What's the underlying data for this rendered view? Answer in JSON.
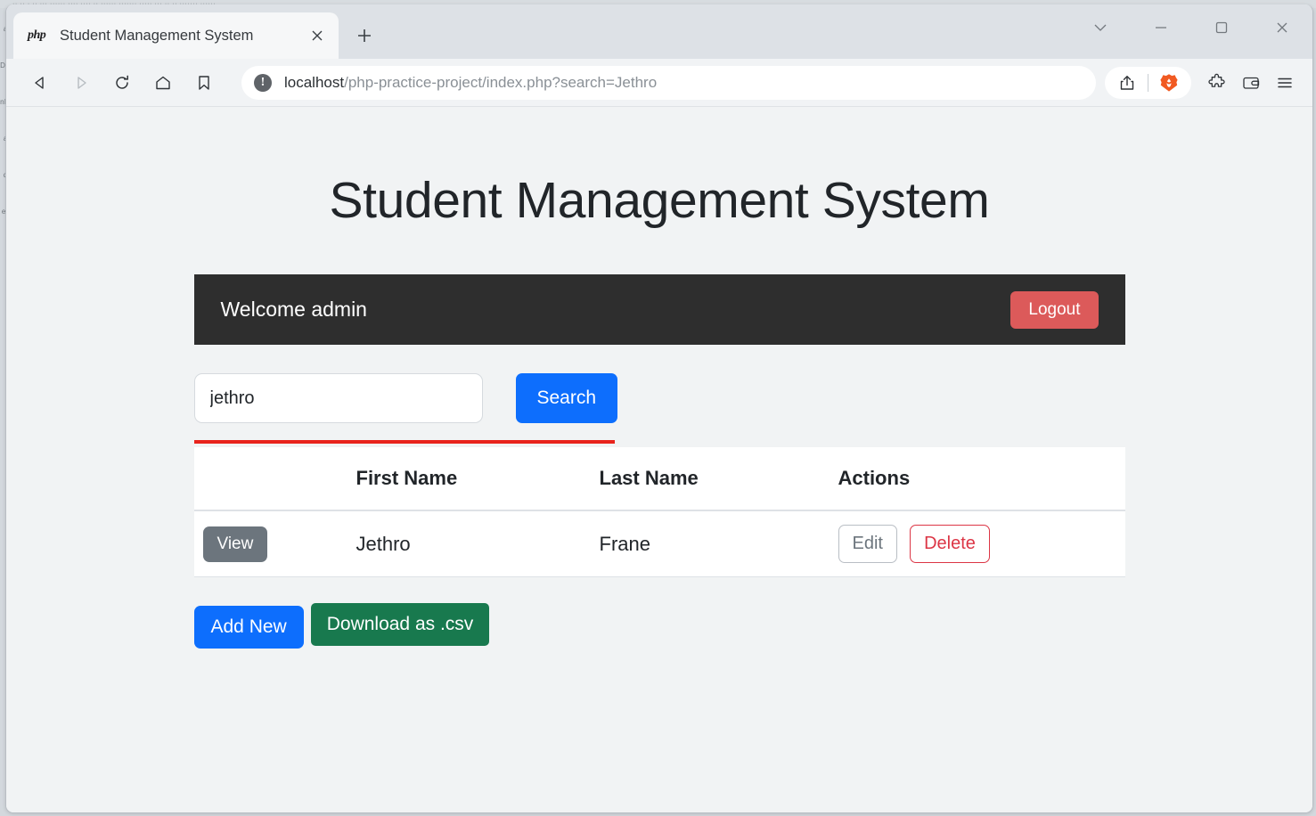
{
  "browser": {
    "tab": {
      "title": "Student Management System",
      "favicon": "php",
      "close_icon": "close-icon",
      "new_tab_icon": "plus-icon"
    },
    "window_controls": {
      "tab_search": "chevron-down-icon",
      "minimize": "minimize-icon",
      "maximize": "maximize-icon",
      "close": "close-icon"
    },
    "toolbar": {
      "back": "back-arrow-icon",
      "forward": "forward-arrow-icon",
      "reload": "reload-icon",
      "home": "home-icon",
      "bookmark": "bookmark-icon",
      "site_info": "!",
      "url_host": "localhost",
      "url_path": "/php-practice-project/index.php?search=Jethro",
      "url_full": "localhost/php-practice-project/index.php?search=Jethro",
      "share": "share-icon",
      "brave_shield": "brave-lion-icon",
      "extensions": "puzzle-icon",
      "wallet": "wallet-icon",
      "menu": "hamburger-menu-icon",
      "brave_orange": "#f15a22"
    }
  },
  "page": {
    "title": "Student Management System",
    "navbar": {
      "welcome": "Welcome admin",
      "logout_label": "Logout",
      "background": "#2e2e2e",
      "logout_color": "#dc5a5a"
    },
    "search": {
      "value": "jethro",
      "placeholder": "",
      "button_label": "Search",
      "button_color": "#0d6efd"
    },
    "divider_color": "#e8231c",
    "table": {
      "headers": [
        "",
        "First Name",
        "Last Name",
        "Actions"
      ],
      "rows": [
        {
          "view_label": "View",
          "first_name": "Jethro",
          "last_name": "Frane",
          "edit_label": "Edit",
          "delete_label": "Delete"
        }
      ]
    },
    "actions": {
      "add_new_label": "Add New",
      "download_label": "Download as .csv",
      "add_new_color": "#0d6efd",
      "download_color": "#18794e"
    }
  },
  "backdrop": {
    "top_strip": "·· ·· · ··  ···  ······ ···· ···· ·· ······ ······· ····· ··· ·· ·· ······· ······",
    "left_strip": "a n D I d n I R a d d e e I c"
  }
}
